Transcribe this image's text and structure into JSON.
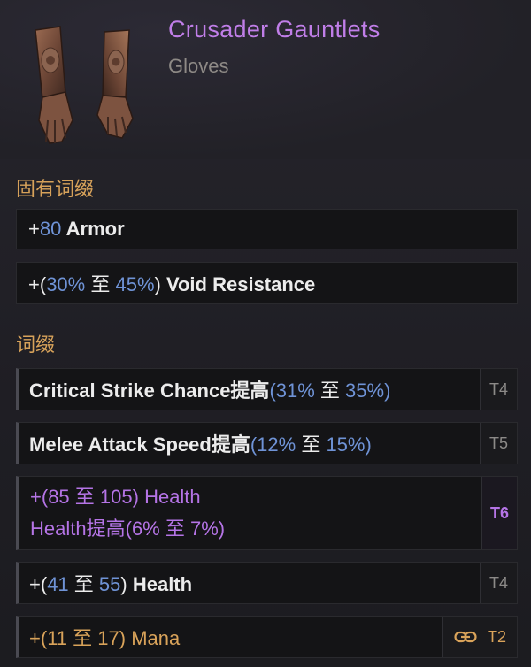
{
  "item": {
    "name": "Crusader Gauntlets",
    "type": "Gloves",
    "icon": "gauntlets-icon"
  },
  "sections": {
    "implicit_title": "固有词缀",
    "affix_title": "词缀"
  },
  "implicits": [
    {
      "prefix": "+",
      "value": "80",
      "label": " Armor"
    },
    {
      "prefix": "+(",
      "min": "30%",
      "sep": " 至 ",
      "max": "45%",
      "close": ")",
      "label": " Void Resistance"
    }
  ],
  "affixes": [
    {
      "label": "Critical Strike Chance提高",
      "open": "(",
      "min": "31%",
      "sep": " 至 ",
      "max": "35%",
      "close": ")",
      "tier": "T4"
    },
    {
      "label": "Melee Attack Speed提高",
      "open": "(",
      "min": "12%",
      "sep": " 至 ",
      "max": "15%",
      "close": ")",
      "tier": "T5"
    },
    {
      "line1": {
        "open": "+(",
        "min": "85",
        "sep": " 至 ",
        "max": "105",
        "close": ")",
        "label": " Health"
      },
      "line2": {
        "label": "Health提高",
        "open": "(",
        "min": "6%",
        "sep": " 至 ",
        "max": "7%",
        "close": ")"
      },
      "tier": "T6"
    },
    {
      "open": "+(",
      "min": "41",
      "sep": " 至 ",
      "max": "55",
      "close": ")",
      "label": " Health",
      "tier": "T4"
    },
    {
      "open": "+(",
      "min": "11",
      "sep": " 至 ",
      "max": "17",
      "close": ")",
      "label": " Mana",
      "tier": "T2",
      "icon": "link-icon"
    }
  ],
  "colors": {
    "name": "#c07ee8",
    "section": "#d7a25a",
    "value": "#6f93d6",
    "set_affix": "#b574e6",
    "idol": "#d9a35a"
  }
}
